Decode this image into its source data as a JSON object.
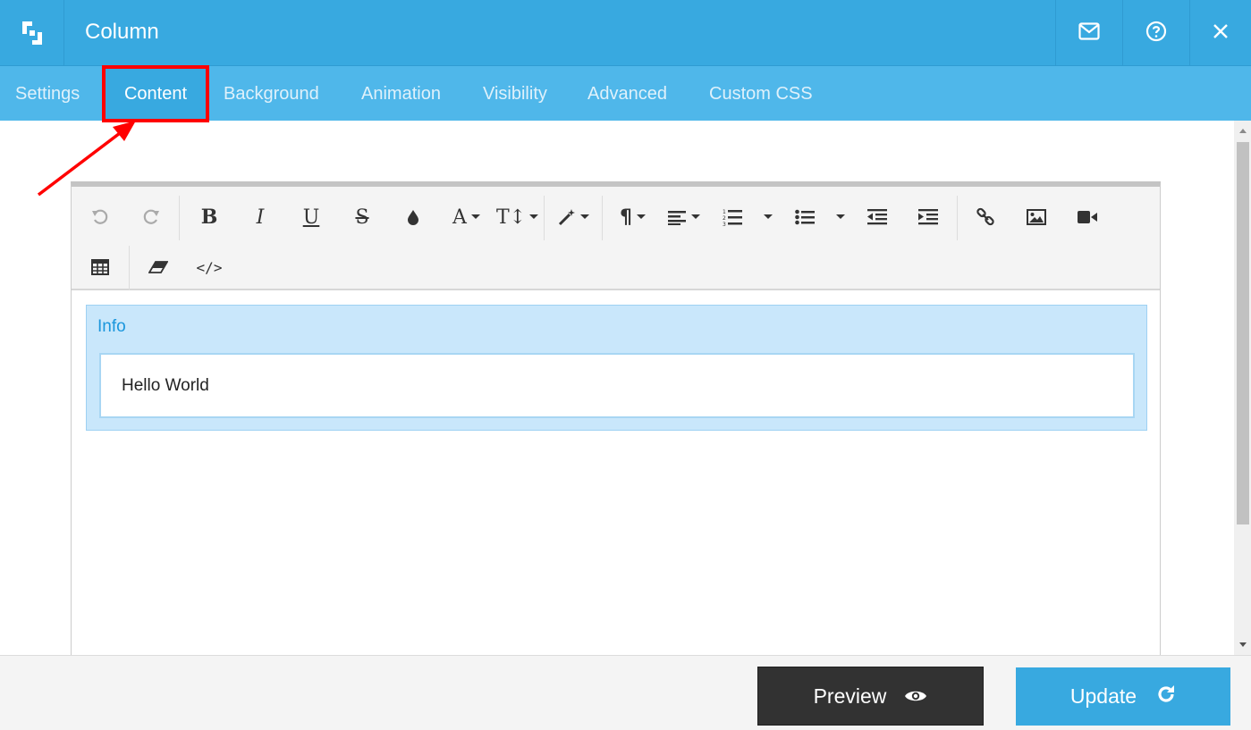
{
  "header": {
    "title": "Column",
    "logo_icon": "builder-logo-icon",
    "actions": [
      {
        "icon": "mail-icon"
      },
      {
        "icon": "help-icon"
      },
      {
        "icon": "close-icon"
      }
    ]
  },
  "tabs": [
    {
      "label": "Settings",
      "active": false
    },
    {
      "label": "Content",
      "active": true
    },
    {
      "label": "Background",
      "active": false
    },
    {
      "label": "Animation",
      "active": false
    },
    {
      "label": "Visibility",
      "active": false
    },
    {
      "label": "Advanced",
      "active": false
    },
    {
      "label": "Custom CSS",
      "active": false
    }
  ],
  "toolbar": {
    "bold": "B",
    "italic": "I",
    "underline": "U",
    "strike": "S",
    "font_family": "A",
    "font_size": "T↕",
    "paragraph": "¶",
    "code_view": "</>"
  },
  "editor": {
    "info_label": "Info",
    "content_text": "Hello World"
  },
  "footer": {
    "preview_label": "Preview",
    "update_label": "Update"
  },
  "colors": {
    "header": "#38a9e0",
    "tabs_bar": "#4fb7ea",
    "annotation": "#ff0000",
    "preview_button": "#323232",
    "update_button": "#38a9e0"
  }
}
